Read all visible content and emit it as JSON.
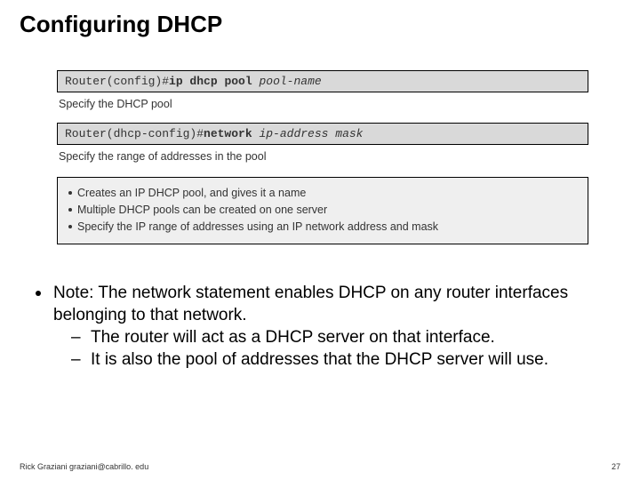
{
  "title": "Configuring DHCP",
  "commands": [
    {
      "prompt": "Router(config)#",
      "cmd": "ip dhcp pool",
      "arg": "pool-name",
      "desc": "Specify the DHCP pool"
    },
    {
      "prompt": "Router(dhcp-config)#",
      "cmd": "network",
      "arg": "ip-address mask",
      "desc": "Specify the range of addresses in the pool"
    }
  ],
  "notes": [
    "Creates an IP DHCP pool, and gives it a name",
    "Multiple DHCP pools can be created on one server",
    "Specify the IP range of addresses using an IP network address and mask"
  ],
  "main_bullet": {
    "text": "Note:  The network statement enables DHCP on any router interfaces belonging to that network.",
    "subs": [
      "The router will act as a DHCP server on that interface.",
      "It is also the pool of addresses that the DHCP server will use."
    ]
  },
  "footer": {
    "author": "Rick Graziani  graziani@cabrillo. edu",
    "page": "27"
  }
}
